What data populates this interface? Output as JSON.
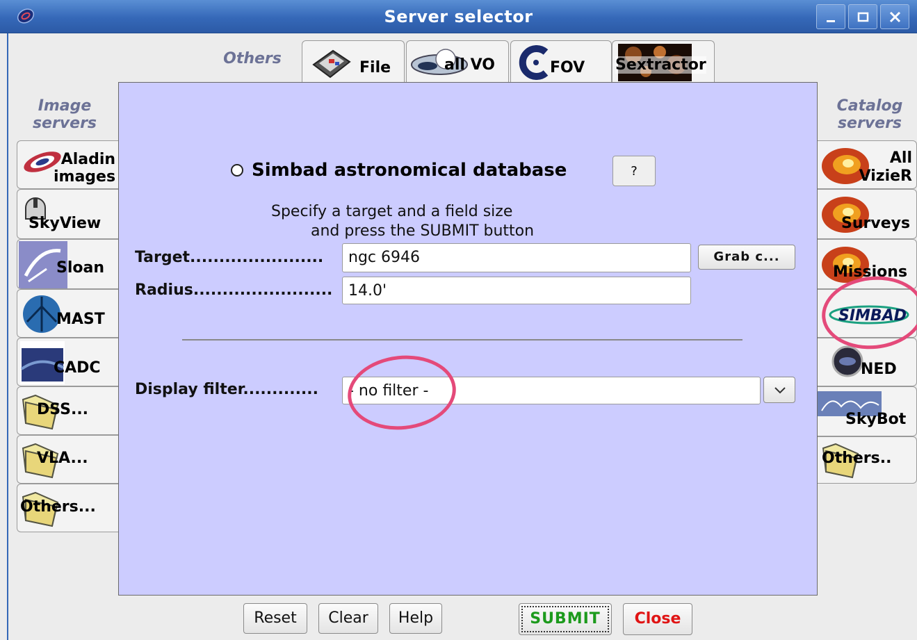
{
  "window": {
    "title": "Server selector"
  },
  "groups": {
    "others": "Others",
    "image_servers": "Image\nservers",
    "catalog_servers": "Catalog\nservers"
  },
  "top_tabs": [
    {
      "id": "file",
      "label": "File"
    },
    {
      "id": "allvo",
      "label": "all VO"
    },
    {
      "id": "fov",
      "label": "FOV"
    },
    {
      "id": "sextractor",
      "label": "Sextractor"
    }
  ],
  "image_servers": [
    {
      "id": "aladin",
      "label": "Aladin\nimages"
    },
    {
      "id": "skyview",
      "label": "SkyView"
    },
    {
      "id": "sloan",
      "label": "Sloan"
    },
    {
      "id": "mast",
      "label": "MAST"
    },
    {
      "id": "cadc",
      "label": "CADC"
    },
    {
      "id": "dss",
      "label": "DSS..."
    },
    {
      "id": "vla",
      "label": "VLA..."
    },
    {
      "id": "others",
      "label": "Others..."
    }
  ],
  "catalog_servers": [
    {
      "id": "vizier",
      "label": "All\nVizieR"
    },
    {
      "id": "surveys",
      "label": "Surveys"
    },
    {
      "id": "missions",
      "label": "Missions"
    },
    {
      "id": "simbad",
      "label": "SIMBAD"
    },
    {
      "id": "ned",
      "label": "NED"
    },
    {
      "id": "skybot",
      "label": "SkyBot"
    },
    {
      "id": "others",
      "label": "Others.."
    }
  ],
  "panel": {
    "heading": "Simbad astronomical database",
    "help_label": "?",
    "instructions_line1": "Specify a target and a field size",
    "instructions_line2": "and press the SUBMIT button",
    "target_label": "Target.......................",
    "target_value": "ngc 6946",
    "grab_label": "Grab c...",
    "radius_label": "Radius........................",
    "radius_value": "14.0'",
    "filter_label": "Display filter.............",
    "filter_value": "- no filter -"
  },
  "buttons": {
    "reset": "Reset",
    "clear": "Clear",
    "help": "Help",
    "submit": "SUBMIT",
    "close": "Close"
  },
  "colors": {
    "panel_bg": "#ccccff",
    "titlebar": "#3568b8",
    "annotation": "#e44a7a",
    "submit": "#1c9a1c",
    "close": "#e01414",
    "group_label": "#6c7296"
  }
}
